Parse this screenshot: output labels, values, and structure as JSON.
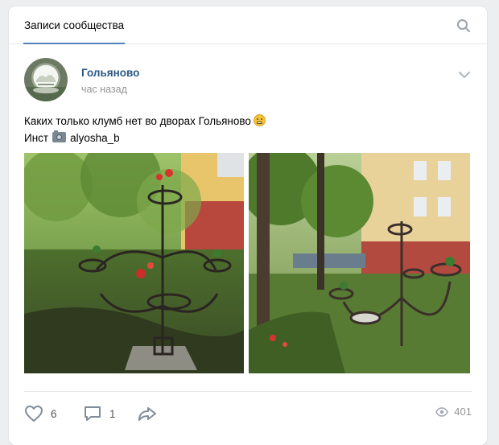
{
  "header": {
    "tab_label": "Записи сообщества",
    "search_icon": "search-icon"
  },
  "post": {
    "author": "Гольяново",
    "time": "час назад",
    "text_line1": "Каких только клумб нет во дворах Гольяново",
    "text_line2_prefix": "Инст",
    "text_line2_handle": "alyosha_b",
    "emoji_icon": "grinning-face-icon",
    "camera_icon": "camera-icon",
    "photos": [
      "photo-flower-stand-1",
      "photo-flower-stand-2"
    ]
  },
  "footer": {
    "likes": "6",
    "comments": "1",
    "views": "401"
  },
  "colors": {
    "accent": "#5181b8",
    "link": "#2a5885",
    "muted": "#939393",
    "background": "#edeef0"
  }
}
